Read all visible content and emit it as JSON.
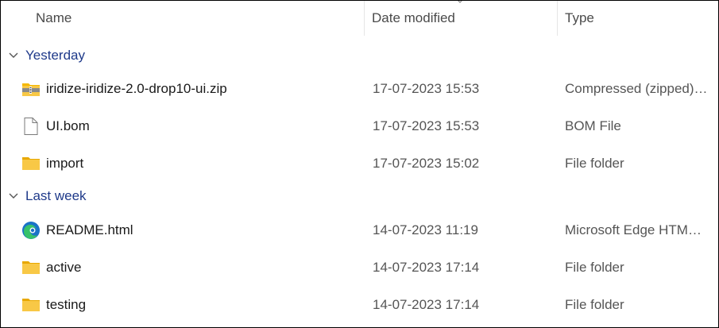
{
  "columns": {
    "name": "Name",
    "date_modified": "Date modified",
    "type": "Type",
    "sort_indicator": "chevron-up-icon"
  },
  "groups": [
    {
      "label": "Yesterday",
      "items": [
        {
          "name": "iridize-iridize-2.0-drop10-ui.zip",
          "date": "17-07-2023 15:53",
          "type": "Compressed (zipped) Folder",
          "icon": "zip-folder-icon"
        },
        {
          "name": "UI.bom",
          "date": "17-07-2023 15:53",
          "type": "BOM File",
          "icon": "file-icon"
        },
        {
          "name": "import",
          "date": "17-07-2023 15:02",
          "type": "File folder",
          "icon": "folder-icon"
        }
      ]
    },
    {
      "label": "Last week",
      "items": [
        {
          "name": "README.html",
          "date": "14-07-2023 11:19",
          "type": "Microsoft Edge HTML Document",
          "icon": "edge-icon"
        },
        {
          "name": "active",
          "date": "14-07-2023 17:14",
          "type": "File folder",
          "icon": "folder-icon"
        },
        {
          "name": "testing",
          "date": "14-07-2023 17:14",
          "type": "File folder",
          "icon": "folder-icon"
        }
      ]
    }
  ],
  "colors": {
    "group_label": "#1f3a8a",
    "folder": "#f8c846",
    "edge_blue": "#1a73c8",
    "edge_green": "#36c26b"
  }
}
